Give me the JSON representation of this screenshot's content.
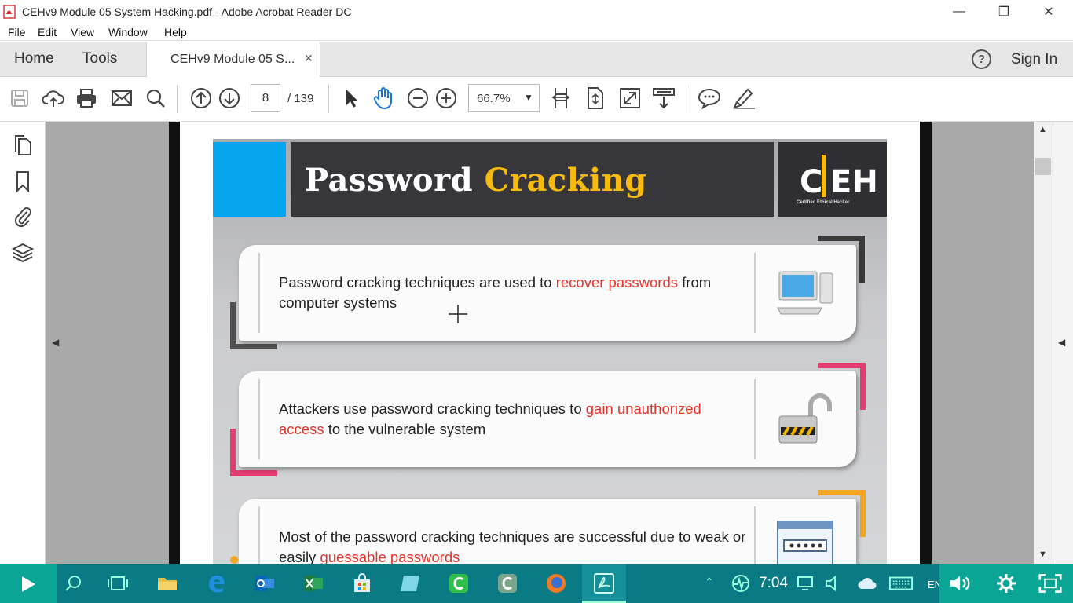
{
  "window": {
    "title": "CEHv9 Module 05 System Hacking.pdf - Adobe Acrobat Reader DC"
  },
  "menu": [
    "File",
    "Edit",
    "View",
    "Window",
    "Help"
  ],
  "tabs": {
    "home": "Home",
    "tools": "Tools",
    "document": "CEHv9 Module 05 S...",
    "sign_in": "Sign In"
  },
  "toolbar": {
    "page_current": "8",
    "page_total": "/ 139",
    "zoom": "66.7%"
  },
  "slide": {
    "title_white": "Password",
    "title_yellow": "Cracking",
    "logo": "C|EH",
    "logo_sub": "Certified   Ethical   Hacker",
    "cards": [
      {
        "pre": "Password cracking techniques are used to ",
        "highlight": "recover passwords",
        "post": " from computer systems",
        "icon": "desktop-computer-icon",
        "accent": "#3a3a3a"
      },
      {
        "pre": "Attackers use password cracking techniques to ",
        "highlight": "gain unauthorized access",
        "post": " to the vulnerable system",
        "icon": "open-padlock-icon",
        "accent": "#e53c72"
      },
      {
        "pre": "Most of the password cracking techniques are successful due to weak or easily ",
        "highlight": "guessable passwords",
        "post": "",
        "icon": "password-window-icon",
        "accent": "#f5a623"
      }
    ]
  },
  "taskbar": {
    "clock": "7:04",
    "lang": "EN"
  }
}
